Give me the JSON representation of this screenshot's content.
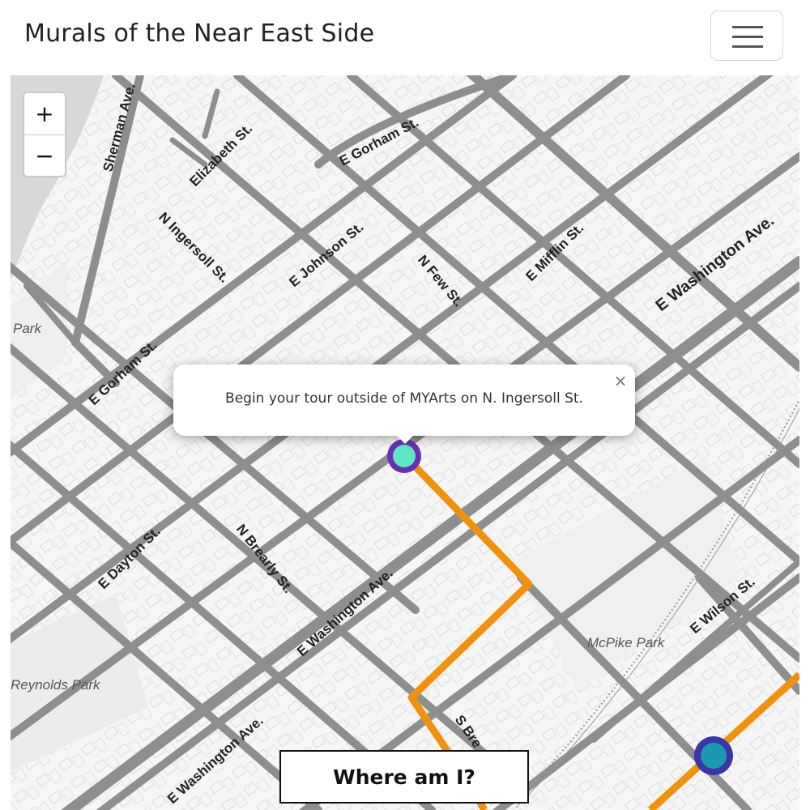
{
  "header": {
    "title": "Murals of the Near East Side",
    "menu_icon": "hamburger-icon"
  },
  "map": {
    "zoom_in_label": "+",
    "zoom_out_label": "−",
    "street_labels": {
      "sherman": "Sherman Ave.",
      "elizabeth": "Elizabeth St.",
      "gorham_top": "E Gorham St.",
      "ingersoll": "N Ingersoll St.",
      "johnson": "E Johnson St.",
      "few": "N Few St.",
      "mifflin": "E Mifflin St.",
      "washington_top": "E Washington Ave.",
      "gorham_left": "E Gorham St.",
      "dayton": "E Dayton St.",
      "brearly": "N Brearly St.",
      "washington_mid": "E Washington Ave.",
      "washington_low": "E Washington Ave.",
      "wilson": "E Wilson St.",
      "s_bre": "S Bre"
    },
    "park_labels": {
      "park": "Park",
      "reynolds": "Reynolds Park",
      "mcpike": "McPike Park"
    },
    "colors": {
      "route": "#f2920c",
      "marker_ring": "#6a2fb5",
      "marker_fill": "#5de8c2",
      "marker2_ring": "#3a35a8",
      "marker2_fill": "#1a9ab0",
      "road": "#8e8e8e"
    }
  },
  "popup": {
    "text": "Begin your tour outside of MYArts on N. Ingersoll St.",
    "close_label": "×"
  },
  "where_button": {
    "label": "Where am I?"
  }
}
